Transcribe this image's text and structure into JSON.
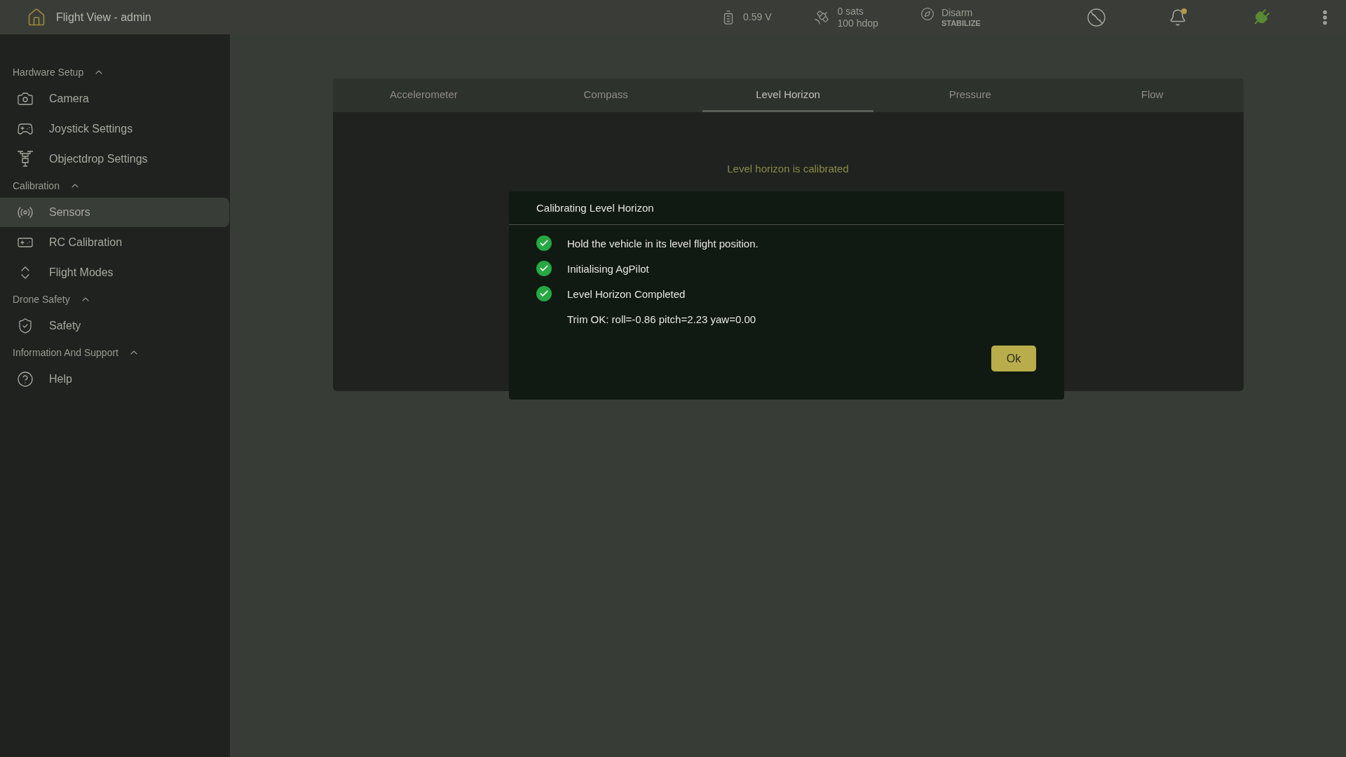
{
  "header": {
    "title": "Flight View - admin"
  },
  "status": {
    "voltage": "0.59 V",
    "sats": "0 sats",
    "hdop": "100 hdop",
    "arm_state": "Disarm",
    "flight_mode": "STABILIZE",
    "notification_dot": true,
    "connected": true
  },
  "sidebar": {
    "sections": [
      {
        "title": "Hardware Setup",
        "expanded": true,
        "items": [
          {
            "label": "Camera",
            "selected": false
          },
          {
            "label": "Joystick Settings",
            "selected": false
          },
          {
            "label": "Objectdrop Settings",
            "selected": false
          }
        ]
      },
      {
        "title": "Calibration",
        "expanded": true,
        "items": [
          {
            "label": "Sensors",
            "selected": true
          },
          {
            "label": "RC Calibration",
            "selected": false
          },
          {
            "label": "Flight Modes",
            "selected": false
          }
        ]
      },
      {
        "title": "Drone Safety",
        "expanded": true,
        "items": [
          {
            "label": "Safety",
            "selected": false
          }
        ]
      },
      {
        "title": "Information And Support",
        "expanded": true,
        "items": [
          {
            "label": "Help",
            "selected": false
          }
        ]
      }
    ]
  },
  "tabs": [
    {
      "label": "Accelerometer",
      "selected": false
    },
    {
      "label": "Compass",
      "selected": false
    },
    {
      "label": "Level Horizon",
      "selected": true
    },
    {
      "label": "Pressure",
      "selected": false
    },
    {
      "label": "Flow",
      "selected": false
    }
  ],
  "panel": {
    "message": "Level horizon is calibrated"
  },
  "dialog": {
    "title": "Calibrating Level Horizon",
    "steps": [
      {
        "text": "Hold the vehicle in its level flight position.",
        "checked": true
      },
      {
        "text": "Initialising AgPilot",
        "checked": true
      },
      {
        "text": "Level Horizon Completed",
        "checked": true
      },
      {
        "text": "Trim OK: roll=-0.86 pitch=2.23 yaw=0.00",
        "checked": false
      }
    ],
    "button": "Ok"
  }
}
